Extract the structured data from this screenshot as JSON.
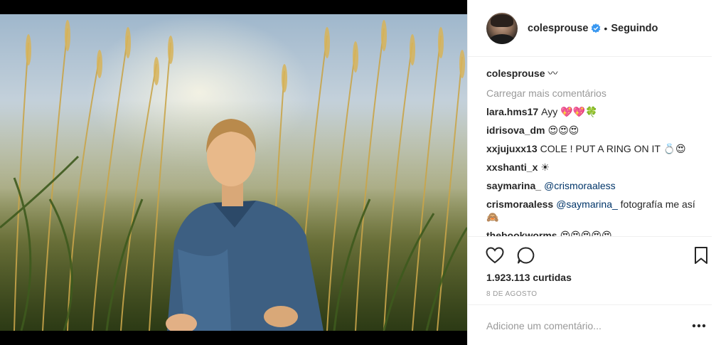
{
  "post": {
    "author": "colesprouse",
    "follow_status": "Seguindo",
    "separator": "•",
    "caption_user": "colesprouse",
    "caption_text": "〰",
    "load_more_label": "Carregar mais comentários",
    "comments": [
      {
        "user": "lara.hms17",
        "text": "Ayy 💖💖🍀",
        "mention": ""
      },
      {
        "user": "idrisova_dm",
        "text": "😍😍😍",
        "mention": ""
      },
      {
        "user": "xxjujuxx13",
        "text": "COLE ! PUT A RING ON IT 💍😍",
        "mention": ""
      },
      {
        "user": "xxshanti_x",
        "text": "☀",
        "mention": ""
      },
      {
        "user": "saymarina_",
        "text": "",
        "mention": "@crismoraaless"
      },
      {
        "user": "crismoraaless",
        "text": "fotografía me así 🙈",
        "mention": "@saymarina_"
      },
      {
        "user": "thebookworms",
        "text": "😍😍😍😍😍",
        "mention": ""
      }
    ],
    "likes_label": "1.923.113 curtidas",
    "date_label": "8 DE AGOSTO",
    "comment_placeholder": "Adicione um comentário...",
    "icons": [
      "verified-icon",
      "heart-icon",
      "comment-icon",
      "bookmark-icon",
      "more-options-icon"
    ],
    "colors": {
      "verified": "#3897f0",
      "text": "#262626",
      "muted": "#999999",
      "border": "#efefef",
      "mention": "#003569"
    }
  }
}
